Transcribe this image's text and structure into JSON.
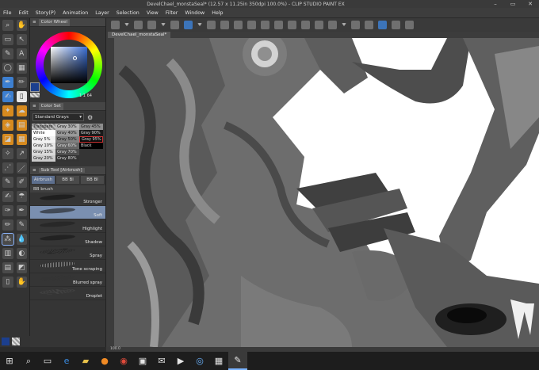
{
  "window": {
    "title": "DevelChael_monstaSeal* (12.57 x 11.25in 350dpi 100.0%) - CLIP STUDIO PAINT EX"
  },
  "menu": [
    "File",
    "Edit",
    "Story(P)",
    "Animation",
    "Layer",
    "Selection",
    "View",
    "Filter",
    "Window",
    "Help"
  ],
  "color_wheel": {
    "tab_label": "Color Wheel",
    "h": "1",
    "s": "1",
    "v": "64",
    "accent": "#1c3f8e"
  },
  "color_set": {
    "tab_label": "Color Set",
    "set_name": "Standard Grays",
    "cells": [
      "Transpare",
      "Gray 30%",
      "Gray 45%",
      "White",
      "Gray 40%",
      "Gray 90%",
      "Gray 5%",
      "Gray 50%",
      "Gray 95%",
      "Gray 10%",
      "Gray 60%",
      "Black",
      "Gray 15%",
      "Gray 70%",
      "",
      "Gray 20%",
      "Gray 80%",
      ""
    ]
  },
  "sub_tool": {
    "tab_label": "Sub Tool [Airbrush]",
    "tabs": [
      "Airbrush",
      "BB Bl",
      "BB Bl"
    ],
    "group_label": "BB brush",
    "brushes": [
      "Stronger",
      "Soft",
      "Highlight",
      "Shadow",
      "Spray",
      "Tone scraping",
      "Blurred spray",
      "Droplet"
    ],
    "active_brush": "Soft"
  },
  "document": {
    "tab": "DevelChael_monstaSeal*"
  },
  "status": {
    "zoom": "100.0"
  }
}
